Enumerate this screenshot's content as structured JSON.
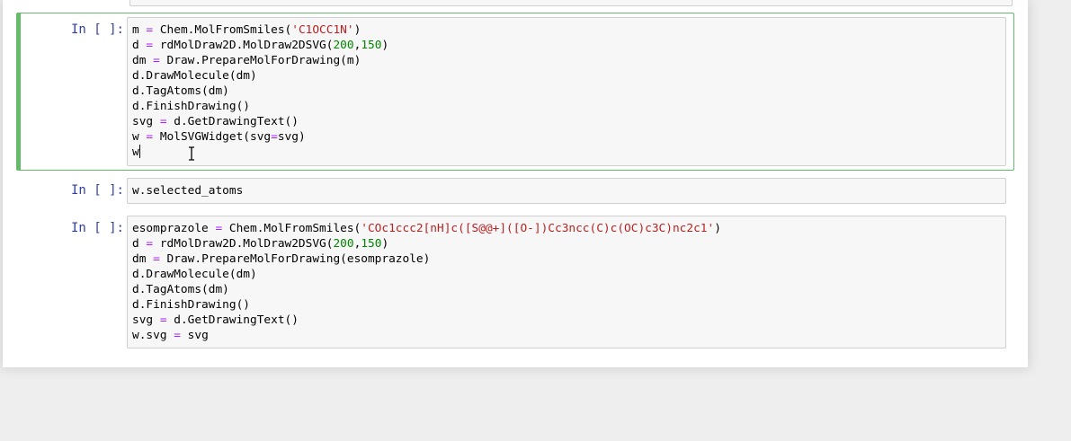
{
  "cells": [
    {
      "prompt": "In [ ]:",
      "selected": true,
      "lines": [
        [
          {
            "t": "m "
          },
          {
            "t": "=",
            "c": "kw-op"
          },
          {
            "t": " Chem.MolFromSmiles("
          },
          {
            "t": "'C1OCC1N'",
            "c": "str"
          },
          {
            "t": ")"
          }
        ],
        [
          {
            "t": "d "
          },
          {
            "t": "=",
            "c": "kw-op"
          },
          {
            "t": " rdMolDraw2D.MolDraw2DSVG("
          },
          {
            "t": "200",
            "c": "num"
          },
          {
            "t": ","
          },
          {
            "t": "150",
            "c": "num"
          },
          {
            "t": ")"
          }
        ],
        [
          {
            "t": "dm "
          },
          {
            "t": "=",
            "c": "kw-op"
          },
          {
            "t": " Draw.PrepareMolForDrawing(m)"
          }
        ],
        [
          {
            "t": "d.DrawMolecule(dm)"
          }
        ],
        [
          {
            "t": "d.TagAtoms(dm)"
          }
        ],
        [
          {
            "t": "d.FinishDrawing()"
          }
        ],
        [
          {
            "t": "svg "
          },
          {
            "t": "=",
            "c": "kw-op"
          },
          {
            "t": " d.GetDrawingText()"
          }
        ],
        [
          {
            "t": "w "
          },
          {
            "t": "=",
            "c": "kw-op"
          },
          {
            "t": " MolSVGWidget(svg"
          },
          {
            "t": "=",
            "c": "kw-op"
          },
          {
            "t": "svg)"
          }
        ],
        [
          {
            "t": "w"
          }
        ]
      ]
    },
    {
      "prompt": "In [ ]:",
      "selected": false,
      "lines": [
        [
          {
            "t": "w.selected_atoms"
          }
        ]
      ]
    },
    {
      "prompt": "In [ ]:",
      "selected": false,
      "lines": [
        [
          {
            "t": "esomprazole "
          },
          {
            "t": "=",
            "c": "kw-op"
          },
          {
            "t": " Chem.MolFromSmiles("
          },
          {
            "t": "'COc1ccc2[nH]c([S@@+]([O-])Cc3ncc(C)c(OC)c3C)nc2c1'",
            "c": "str"
          },
          {
            "t": ")"
          }
        ],
        [
          {
            "t": "d "
          },
          {
            "t": "=",
            "c": "kw-op"
          },
          {
            "t": " rdMolDraw2D.MolDraw2DSVG("
          },
          {
            "t": "200",
            "c": "num"
          },
          {
            "t": ","
          },
          {
            "t": "150",
            "c": "num"
          },
          {
            "t": ")"
          }
        ],
        [
          {
            "t": "dm "
          },
          {
            "t": "=",
            "c": "kw-op"
          },
          {
            "t": " Draw.PrepareMolForDrawing(esomprazole)"
          }
        ],
        [
          {
            "t": "d.DrawMolecule(dm)"
          }
        ],
        [
          {
            "t": "d.TagAtoms(dm)"
          }
        ],
        [
          {
            "t": "d.FinishDrawing()"
          }
        ],
        [
          {
            "t": "svg "
          },
          {
            "t": "=",
            "c": "kw-op"
          },
          {
            "t": " d.GetDrawingText()"
          }
        ],
        [
          {
            "t": "w.svg "
          },
          {
            "t": "=",
            "c": "kw-op"
          },
          {
            "t": " svg"
          }
        ]
      ]
    }
  ],
  "colors": {
    "selected_border": "#66bb6a",
    "prompt": "#303f9f",
    "keyword_operator": "#aa22ff",
    "string": "#ba2121",
    "number": "#008800"
  }
}
